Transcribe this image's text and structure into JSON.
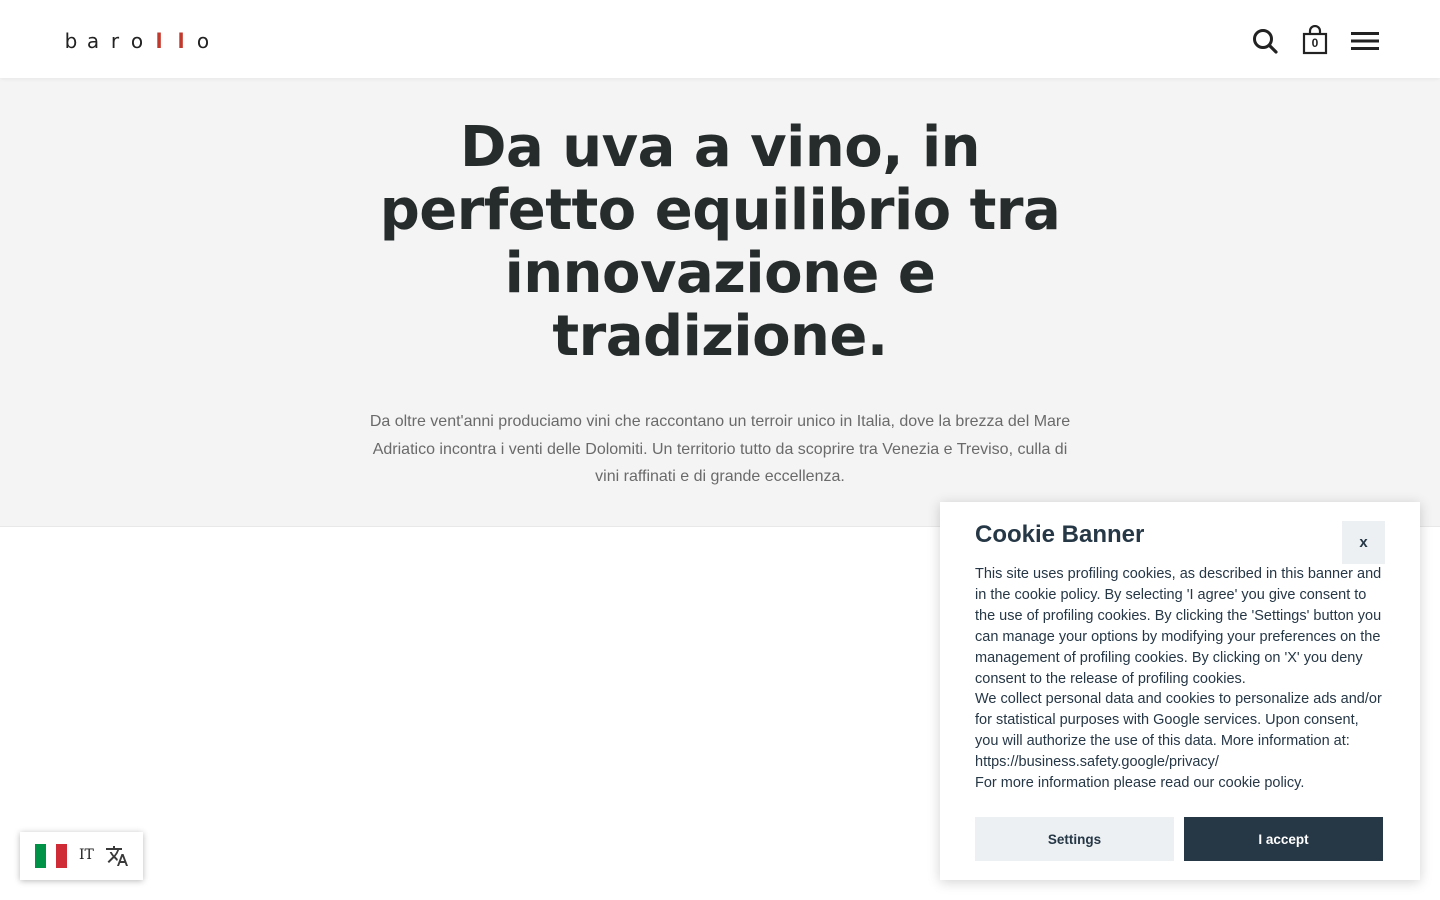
{
  "header": {
    "logo_letters": [
      "b",
      "a",
      "r",
      "o",
      "l",
      "l",
      "o"
    ],
    "logo_accent_color": "#c0392b",
    "cart_count": "0",
    "icons": [
      "search-icon",
      "shopping-bag-icon",
      "hamburger-menu-icon"
    ]
  },
  "hero": {
    "title": "Da uva a vino, in perfetto equilibrio tra innovazione e tradizione.",
    "description": "Da oltre vent'anni produciamo vini che raccontano un terroir unico in Italia, dove la brezza del Mare Adriatico incontra i venti delle Dolomiti. Un territorio tutto da scoprire tra Venezia e Treviso, culla di vini raffinati e di grande eccellenza."
  },
  "cookie_banner": {
    "title": "Cookie Banner",
    "close_label": "x",
    "paragraph_1": "This site uses profiling cookies, as described in this banner and in the cookie policy. By selecting 'I agree' you give consent to the use of profiling cookies. By clicking the 'Settings' button you can manage your options by modifying your preferences on the management of profiling cookies. By clicking on 'X' you deny consent to the release of profiling cookies.",
    "paragraph_2": "We collect personal data and cookies to personalize ads and/or for statistical purposes with Google services. Upon consent, you will authorize the use of this data. More information at: https://business.safety.google/privacy/",
    "paragraph_3": "For more information please read our cookie policy.",
    "settings_label": "Settings",
    "accept_label": "I accept",
    "accent_color": "#263746"
  },
  "language_switcher": {
    "code": "IT",
    "flag_colors": [
      "#009246",
      "#ffffff",
      "#ce2b37"
    ],
    "icon": "translate-icon"
  }
}
